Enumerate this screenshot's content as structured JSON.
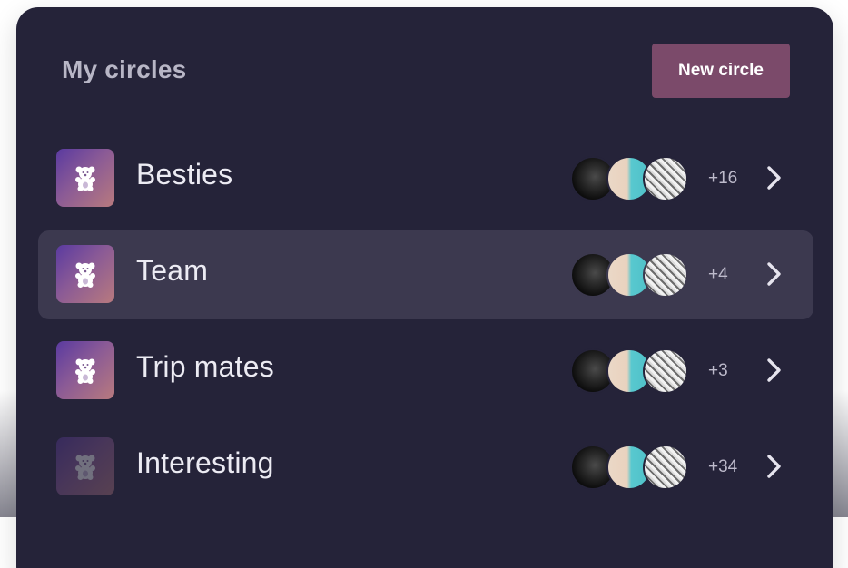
{
  "header": {
    "title": "My circles",
    "new_button_label": "New circle"
  },
  "circles": [
    {
      "name": "Besties",
      "extra_count": "+16",
      "selected": false,
      "dimmed": false
    },
    {
      "name": "Team",
      "extra_count": "+4",
      "selected": true,
      "dimmed": false
    },
    {
      "name": "Trip mates",
      "extra_count": "+3",
      "selected": false,
      "dimmed": false
    },
    {
      "name": "Interesting",
      "extra_count": "+34",
      "selected": false,
      "dimmed": true
    }
  ],
  "icons": {
    "circle_icon": "teddy-bear-icon",
    "row_action": "chevron-right-icon"
  },
  "colors": {
    "card_background": "#252339",
    "selected_row": "#3c394f",
    "primary_button": "#7b4a6a",
    "title_text": "#b8b6c6",
    "name_text": "#ecebf3"
  }
}
